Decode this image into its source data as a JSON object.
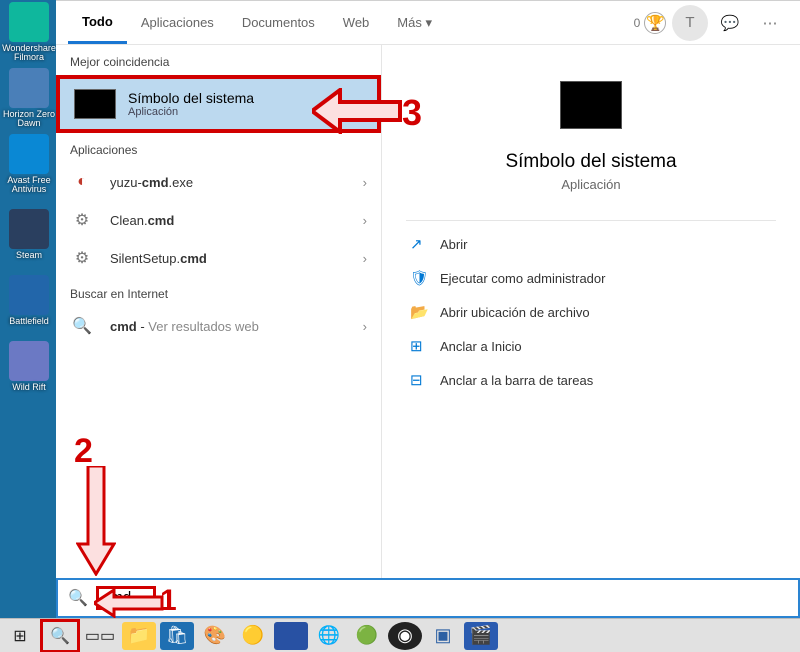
{
  "desktop": {
    "icons": [
      {
        "label": "Wondershare Filmora",
        "color": "#0fb79d"
      },
      {
        "label": "Horizon Zero Dawn",
        "color": "#4a7fb8"
      },
      {
        "label": "Avast Free Antivirus",
        "color": "#0a88d4"
      },
      {
        "label": "Steam",
        "color": "#2a3f5f"
      },
      {
        "label": "Battlefield",
        "color": "#2266aa"
      },
      {
        "label": "Wild Rift",
        "color": "#6b79c4"
      }
    ]
  },
  "tabs": {
    "items": [
      "Todo",
      "Aplicaciones",
      "Documentos",
      "Web",
      "Más"
    ],
    "active": 0,
    "points": "0",
    "user_initial": "T"
  },
  "sections": {
    "best_match": "Mejor coincidencia",
    "apps": "Aplicaciones",
    "internet": "Buscar en Internet"
  },
  "best": {
    "title": "Símbolo del sistema",
    "subtitle": "Aplicación"
  },
  "app_results": [
    {
      "pre": "yuzu-",
      "bold": "cmd",
      "post": ".exe",
      "icon": "yuzu"
    },
    {
      "pre": "Clean.",
      "bold": "cmd",
      "post": "",
      "icon": "bat"
    },
    {
      "pre": "SilentSetup.",
      "bold": "cmd",
      "post": "",
      "icon": "bat"
    }
  ],
  "internet_result": {
    "pre": "",
    "bold": "cmd",
    "post": " - ",
    "hint": "Ver resultados web"
  },
  "preview": {
    "title": "Símbolo del sistema",
    "subtitle": "Aplicación",
    "actions": [
      {
        "icon": "open",
        "label": "Abrir"
      },
      {
        "icon": "admin",
        "label": "Ejecutar como administrador"
      },
      {
        "icon": "folder",
        "label": "Abrir ubicación de archivo"
      },
      {
        "icon": "pin-start",
        "label": "Anclar a Inicio"
      },
      {
        "icon": "pin-taskbar",
        "label": "Anclar a la barra de tareas"
      }
    ]
  },
  "search": {
    "query": "cmd"
  },
  "taskbar": {
    "apps": [
      "task-view",
      "explorer",
      "store",
      "paint",
      "chrome",
      "terminal",
      "edge",
      "chrome-canary",
      "obs",
      "virtualbox",
      "video-editor"
    ]
  },
  "annotations": {
    "n1": "1",
    "n2": "2",
    "n3": "3"
  }
}
